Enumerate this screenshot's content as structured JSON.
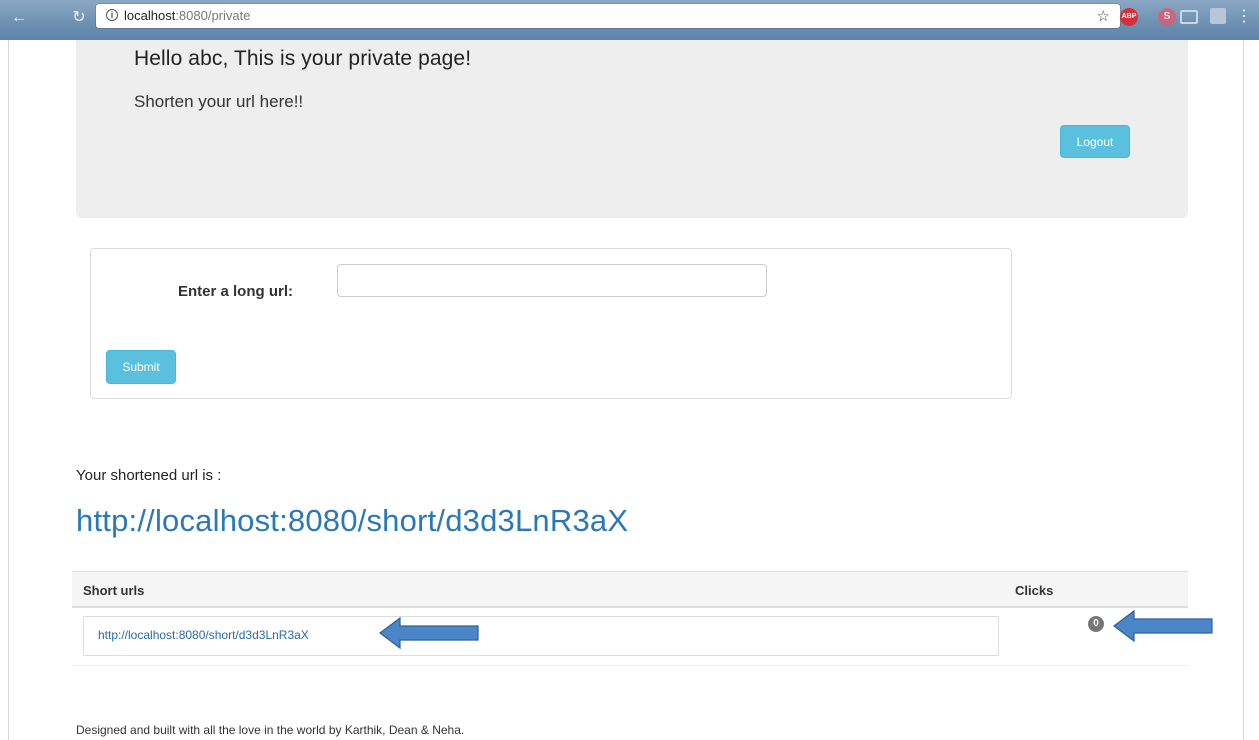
{
  "browser": {
    "url_host": "localhost",
    "url_path": ":8080/private"
  },
  "header": {
    "greeting": "Hello abc, This is your private page!",
    "subtitle": "Shorten your url here!!",
    "logout_label": "Logout"
  },
  "form": {
    "label": "Enter a long url:",
    "input_value": "",
    "submit_label": "Submit"
  },
  "result": {
    "label": "Your shortened url is :",
    "short_url": "http://localhost:8080/short/d3d3LnR3aX"
  },
  "table": {
    "columns": [
      "Short urls",
      "Clicks"
    ],
    "rows": [
      {
        "short_url": "http://localhost:8080/short/d3d3LnR3aX",
        "clicks": "0"
      }
    ]
  },
  "footer": {
    "text": "Designed and built with all the love in the world by Karthik, Dean & Neha."
  },
  "colors": {
    "accent": "#5bc0de",
    "link": "#2a78b8",
    "annotation_arrow": "#4a86c8"
  }
}
